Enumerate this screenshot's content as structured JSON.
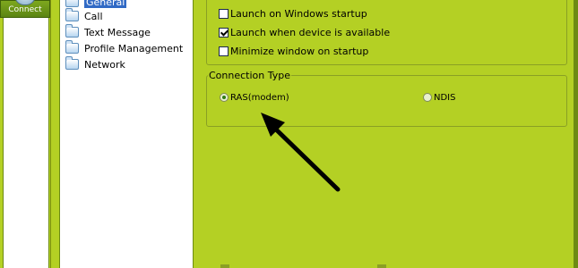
{
  "left_bar": {
    "connect_label": "Connect"
  },
  "tree": {
    "items": [
      {
        "label": "General",
        "selected": true
      },
      {
        "label": "Call"
      },
      {
        "label": "Text Message"
      },
      {
        "label": "Profile Management"
      },
      {
        "label": "Network"
      }
    ]
  },
  "general": {
    "options": [
      {
        "label": "Launch on Windows startup",
        "checked": false
      },
      {
        "label": "Launch when device is available",
        "checked": true
      },
      {
        "label": "Minimize window on startup",
        "checked": false
      }
    ]
  },
  "connection_type": {
    "legend": "Connection Type",
    "options": [
      {
        "label": "RAS(modem)",
        "selected": true
      },
      {
        "label": "NDIS",
        "selected": false
      }
    ]
  },
  "colors": {
    "background": "#b4d024",
    "selection": "#316ac5",
    "arrow": "#000000"
  }
}
